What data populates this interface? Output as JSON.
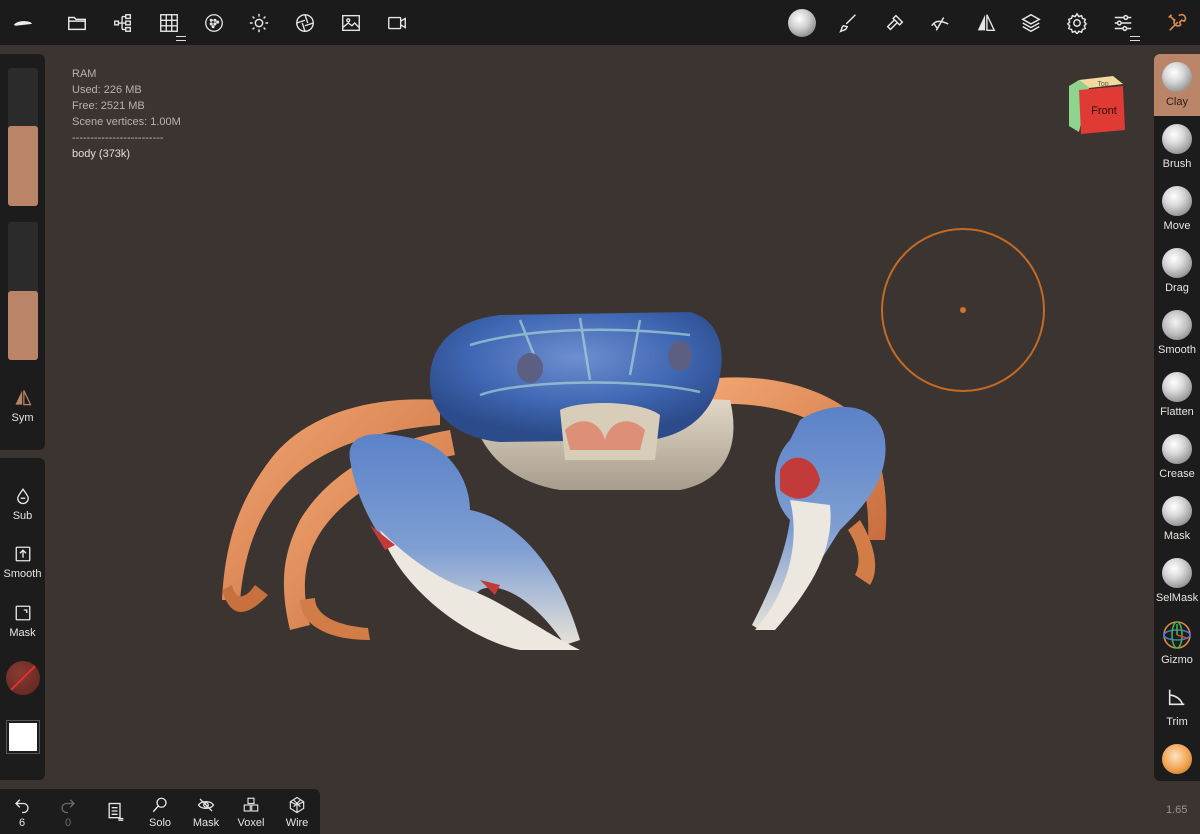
{
  "stats": {
    "ram_label": "RAM",
    "used": "Used: 226 MB",
    "free": "Free: 2521 MB",
    "scene_vertices": "Scene vertices: 1.00M",
    "separator": "-------------------------",
    "object": "body (373k)"
  },
  "left_panel": {
    "sym": "Sym",
    "sub": "Sub",
    "smooth": "Smooth",
    "mask": "Mask",
    "radius_slider_value": 0.58,
    "intensity_slider_value": 0.5
  },
  "bottom_bar": {
    "undo_count": "6",
    "redo_count": "0",
    "solo": "Solo",
    "mask": "Mask",
    "voxel": "Voxel",
    "wire": "Wire"
  },
  "tools": [
    {
      "label": "Clay"
    },
    {
      "label": "Brush"
    },
    {
      "label": "Move"
    },
    {
      "label": "Drag"
    },
    {
      "label": "Smooth"
    },
    {
      "label": "Flatten"
    },
    {
      "label": "Crease"
    },
    {
      "label": "Mask"
    },
    {
      "label": "SelMask"
    },
    {
      "label": "Gizmo"
    },
    {
      "label": "Trim"
    }
  ],
  "view_cube": {
    "front": "Front",
    "top": "Top"
  },
  "zoom": "1.65",
  "colors": {
    "accent": "#b98467",
    "brush_ring": "#c46a24",
    "background": "#3b3431",
    "panel": "#1c1c1c"
  }
}
